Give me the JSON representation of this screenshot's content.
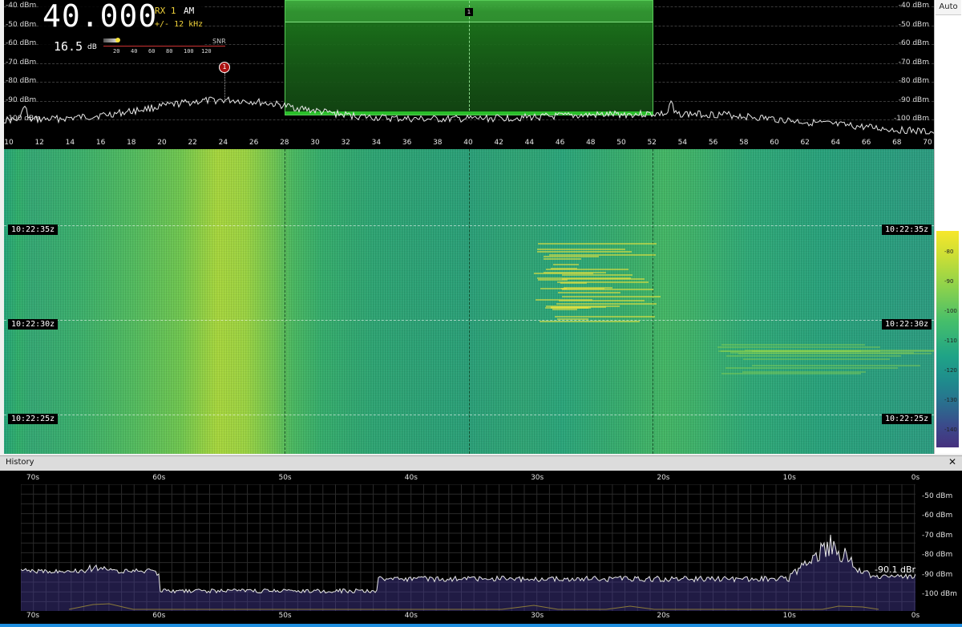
{
  "spectrum": {
    "frequency": "40.000",
    "rx": "RX 1",
    "mode": "AM",
    "bandwidth": "+/- 12 kHz",
    "snr_value": "16.5",
    "snr_unit": "dB",
    "snr_label": "SNR",
    "snr_scale": [
      "20",
      "40",
      "60",
      "80",
      "100",
      "120"
    ],
    "snr_level_db": 16.5,
    "marker": "1",
    "passband_label": "1",
    "db_levels": [
      "-40 dBm",
      "-50 dBm",
      "-60 dBm",
      "-70 dBm",
      "-80 dBm",
      "-90 dBm",
      "-100 dBm"
    ],
    "freq_ticks": [
      "10",
      "12",
      "14",
      "16",
      "18",
      "20",
      "22",
      "24",
      "26",
      "28",
      "30",
      "32",
      "34",
      "36",
      "38",
      "40",
      "42",
      "44",
      "46",
      "48",
      "50",
      "52",
      "54",
      "56",
      "58",
      "60",
      "62",
      "64",
      "66",
      "68",
      "70"
    ]
  },
  "right_panel": {
    "auto_label": "Auto",
    "colorbar_levels": [
      "-70",
      "-80",
      "-90",
      "-100",
      "-110",
      "-120",
      "-130",
      "-140"
    ]
  },
  "waterfall": {
    "timestamps": [
      "10:22:35z",
      "10:22:30z",
      "10:22:25z"
    ]
  },
  "history": {
    "title": "History",
    "close_icon": "close-icon",
    "x_ticks": [
      "70s",
      "60s",
      "50s",
      "40s",
      "30s",
      "20s",
      "10s",
      "0s"
    ],
    "y_ticks": [
      "-50 dBm",
      "-60 dBm",
      "-70 dBm",
      "-80 dBm",
      "-90 dBm",
      "-100 dBm"
    ],
    "current_level": "-90.1 dBm"
  },
  "colors": {
    "accent_yellow": "#f0d23a",
    "passband_green": "#2ecf2e",
    "trace": "#e8e8e8",
    "marker_red": "#a11111"
  }
}
